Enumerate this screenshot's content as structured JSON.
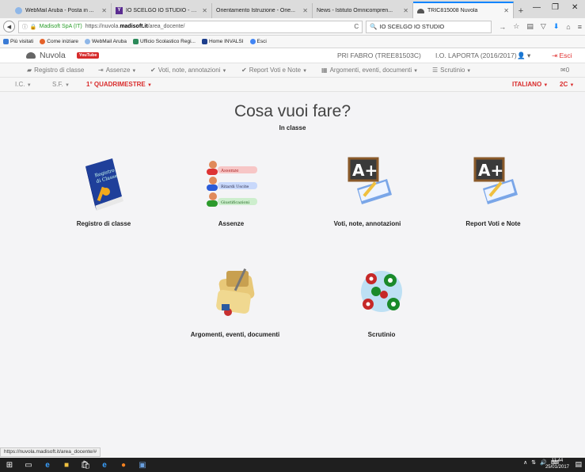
{
  "browser": {
    "tabs": [
      {
        "label": "WebMail Aruba - Posta in ...",
        "icon": "webmail-icon",
        "color": "#8fb7e8"
      },
      {
        "label": "IO SCELGO IO STUDIO - Ri...",
        "icon": "yahoo-icon",
        "color": "#5b2d91"
      },
      {
        "label": "Orientamento Istruzione - Orie...",
        "icon": "page-icon",
        "color": "#c8c8c8"
      },
      {
        "label": "News - Istituto Omnicompren...",
        "icon": "page-icon",
        "color": "#c8c8c8"
      },
      {
        "label": "TRIC815008 Nuvola",
        "icon": "cloud-icon",
        "color": "#555555"
      }
    ],
    "new_tab": "+",
    "window_controls": {
      "minimize": "—",
      "maximize": "❐",
      "close": "✕"
    },
    "url": {
      "org": "Madisoft SpA (IT)",
      "prefix": "https://nuvola.",
      "host": "madisoft.it",
      "path": "/area_docente/"
    },
    "search": "IO SCELGO IO STUDIO",
    "bookmarks": [
      {
        "label": "Più visitati",
        "color": "#3a7bd5"
      },
      {
        "label": "Come iniziare",
        "color": "#e5622a"
      },
      {
        "label": "WebMail Aruba",
        "color": "#8fb7e8"
      },
      {
        "label": "Ufficio Scolastico Regi...",
        "color": "#2c8a5a"
      },
      {
        "label": "Home INVALSI",
        "color": "#1d3e8c"
      },
      {
        "label": "Esci",
        "color": "#4285f4"
      }
    ],
    "status_url": "https://nuvola.madisoft.it/area_docente/#"
  },
  "app": {
    "name": "Nuvola",
    "youtube": "YouTube",
    "teacher": "PRI FABRO (TREE81503C)",
    "school": "I.O. LAPORTA (2016/2017)",
    "user_caret": "▾",
    "exit": "Esci",
    "menu": [
      {
        "label": "Registro di classe",
        "icon": "book-icon",
        "caret": false
      },
      {
        "label": "Assenze",
        "icon": "signin-icon",
        "caret": true
      },
      {
        "label": "Voti, note, annotazioni",
        "icon": "check-icon",
        "caret": true
      },
      {
        "label": "Report Voti e Note",
        "icon": "check-icon",
        "caret": true
      },
      {
        "label": "Argomenti, eventi, documenti",
        "icon": "list-icon",
        "caret": true
      },
      {
        "label": "Scrutinio",
        "icon": "list-icon",
        "caret": true
      }
    ],
    "messages": "0",
    "subbar": {
      "ic": "I.C.",
      "sf": "S.F.",
      "period": "1° QUADRIMESTRE",
      "subject": "ITALIANO",
      "class": "2C"
    }
  },
  "main": {
    "title": "Cosa vuoi fare?",
    "subtitle": "In classe",
    "cards": [
      {
        "label": "Registro di classe",
        "icon": "registro-book-icon"
      },
      {
        "label": "Assenze",
        "icon": "assenze-people-icon",
        "lines": [
          "Assenze",
          "Ritardi Uscite",
          "Giustificazioni"
        ]
      },
      {
        "label": "Voti, note, annotazioni",
        "icon": "grade-aplus-icon"
      },
      {
        "label": "Report Voti e Note",
        "icon": "grade-aplus-icon"
      },
      {
        "label": "Argomenti, eventi, documenti",
        "icon": "scroll-documents-icon"
      },
      {
        "label": "Scrutinio",
        "icon": "billiard-balls-icon"
      }
    ]
  },
  "taskbar": {
    "time": "11:44",
    "date": "25/01/2017"
  }
}
